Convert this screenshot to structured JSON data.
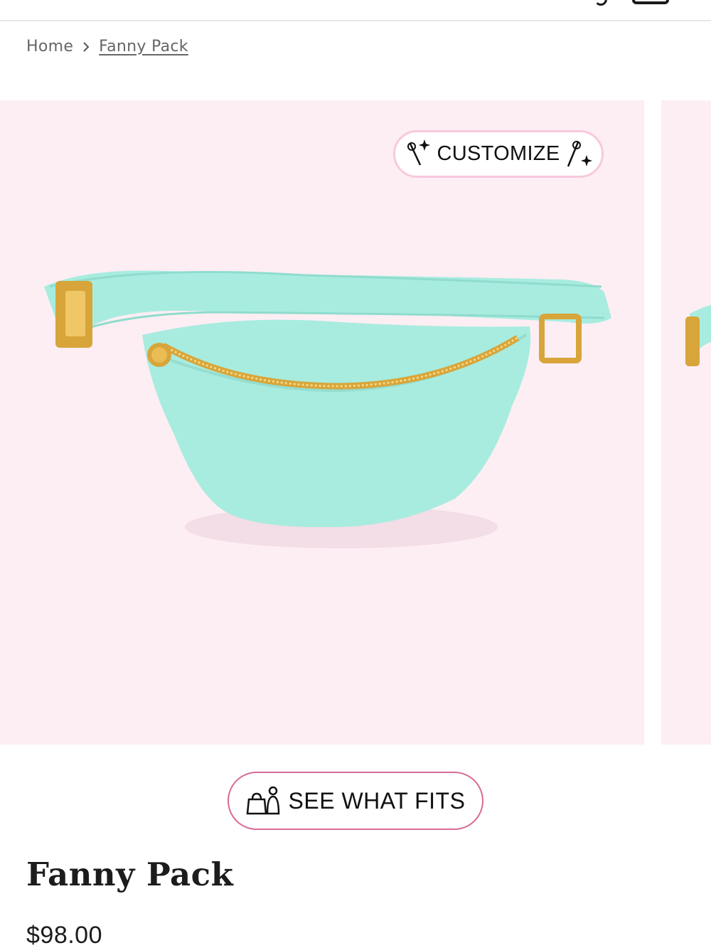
{
  "header": {
    "icons": [
      "account-icon",
      "cart-icon"
    ]
  },
  "breadcrumb": {
    "home": "Home",
    "separator_icon": "chevron-right-icon",
    "current": "Fanny Pack"
  },
  "gallery": {
    "background_color": "#fdeef4",
    "customize_label": "CUSTOMIZE",
    "customize_icon": "sparkle-pin-icon",
    "product_color": "#a8ecdf",
    "hardware_color": "#d8a53a"
  },
  "see_what_fits": {
    "label": "SEE WHAT FITS",
    "icon": "bag-person-icon",
    "border_color": "#d86a97"
  },
  "product": {
    "title": "Fanny Pack",
    "price": "$98.00"
  }
}
